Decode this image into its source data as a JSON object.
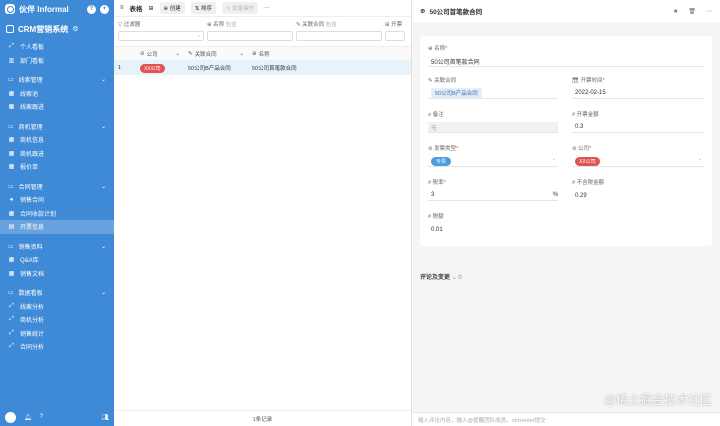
{
  "sidebar": {
    "brand": "伙伴 Informal",
    "app_title": "CRM营销系统",
    "items": [
      {
        "icon": "chart-line-icon",
        "label": "个人看板",
        "type": "item"
      },
      {
        "icon": "chart-bar-icon",
        "label": "部门看板",
        "type": "item"
      },
      {
        "label": "线索管理",
        "type": "group"
      },
      {
        "icon": "grid-icon",
        "label": "线索池",
        "type": "item"
      },
      {
        "icon": "grid-icon",
        "label": "线索跟进",
        "type": "item"
      },
      {
        "label": "商机管理",
        "type": "group"
      },
      {
        "icon": "grid-icon",
        "label": "商机信息",
        "type": "item"
      },
      {
        "icon": "grid-icon",
        "label": "商机跟进",
        "type": "item"
      },
      {
        "icon": "grid-icon",
        "label": "报价单",
        "type": "item"
      },
      {
        "label": "合同管理",
        "type": "group"
      },
      {
        "icon": "dot-icon",
        "label": "销售合同",
        "type": "item"
      },
      {
        "icon": "grid-icon",
        "label": "合同收款计划",
        "type": "item"
      },
      {
        "icon": "doc-icon",
        "label": "开票信息",
        "type": "item",
        "active": true
      },
      {
        "label": "销售资料",
        "type": "group"
      },
      {
        "icon": "grid-icon",
        "label": "Q&A库",
        "type": "item"
      },
      {
        "icon": "grid-icon",
        "label": "销售文档",
        "type": "item"
      },
      {
        "label": "数据看板",
        "type": "group"
      },
      {
        "icon": "chart-line-icon",
        "label": "线索分析",
        "type": "item"
      },
      {
        "icon": "chart-line-icon",
        "label": "商机分析",
        "type": "item"
      },
      {
        "icon": "chart-line-icon",
        "label": "销售统计",
        "type": "item"
      },
      {
        "icon": "chart-line-icon",
        "label": "合同分析",
        "type": "item"
      }
    ]
  },
  "list": {
    "title": "表格",
    "toolbar": {
      "create": "创建",
      "sort": "排序",
      "batch_edit": "批量操作",
      "more": "···"
    },
    "filters": [
      {
        "label": "过滤器",
        "hint": ""
      },
      {
        "label": "名称",
        "hint": "包含"
      },
      {
        "label": "关联合同",
        "hint": "包含"
      },
      {
        "label": "开票",
        "hint": ""
      }
    ],
    "columns": [
      "公司",
      "关联合同",
      "名称"
    ],
    "rows": [
      {
        "index": "1",
        "company": "XX公司",
        "contract": "50公司B产品合同",
        "name": "50公司首笔款合同"
      }
    ],
    "footer": "1条记录"
  },
  "detail": {
    "title": "50公司首笔款合同",
    "fields": {
      "name_label": "名称",
      "name_value": "50公司首笔款合同",
      "contract_label": "关联合同",
      "contract_value": "50公司B产品合同",
      "date_label": "开票时间",
      "date_value": "2022-02-15",
      "note_label": "备注",
      "note_value": "无",
      "amount_label": "开票金额",
      "amount_value": "0.3",
      "invoice_type_label": "发票类型",
      "invoice_type_value": "专票",
      "company_label": "公司",
      "company_value": "XX公司",
      "tax_rate_label": "税率",
      "tax_rate_value": "3",
      "tax_rate_unit": "%",
      "pretax_label": "不含税金额",
      "pretax_value": "0.29",
      "tax_label": "税额",
      "tax_value": "0.01"
    },
    "comments_label": "评论及变更",
    "comments_count": "0",
    "comment_placeholder": "输入评论内容，输入@提醒团队成员，ctrl+enter提交"
  },
  "watermark": "@稀土掘金技术社区",
  "colors": {
    "sidebar": "#3f8ad6",
    "tag_red": "#e05353",
    "tag_blue": "#4b9be0",
    "row_selected": "#e6f3fb"
  }
}
